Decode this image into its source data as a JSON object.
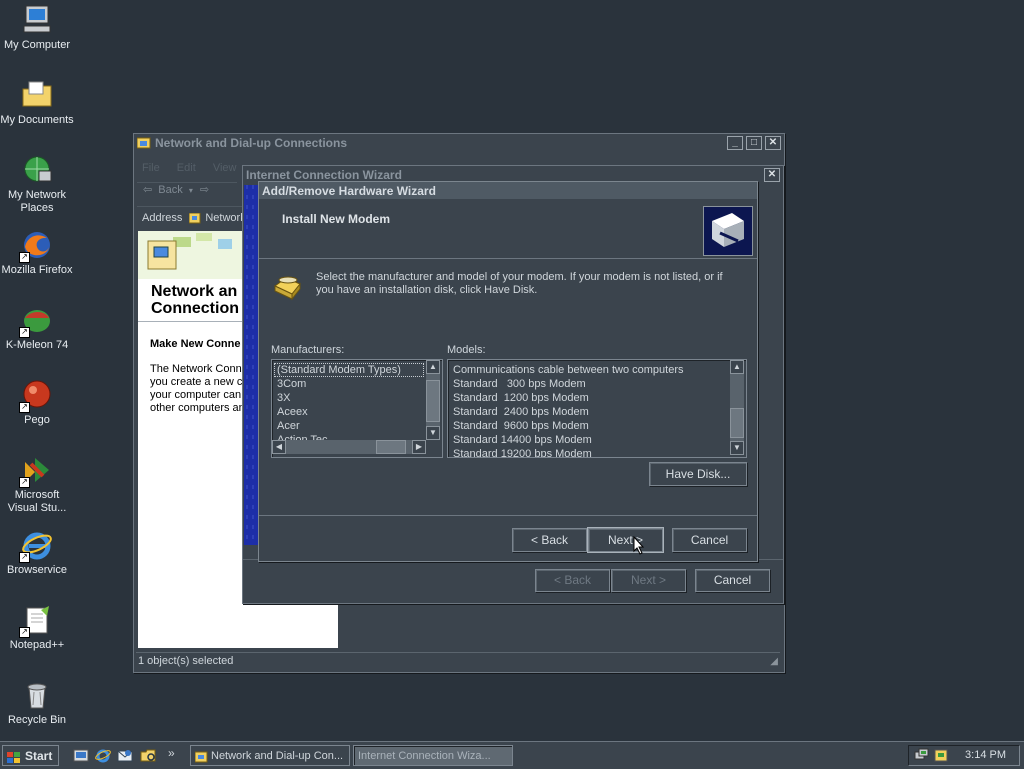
{
  "desktop": {
    "icons": [
      {
        "label": "My Computer"
      },
      {
        "label": "My Documents"
      },
      {
        "label": "My Network Places"
      },
      {
        "label": "Mozilla Firefox"
      },
      {
        "label": "K-Meleon 74"
      },
      {
        "label": "Pego"
      },
      {
        "label": "Microsoft Visual Stu..."
      },
      {
        "label": "Browservice"
      },
      {
        "label": "Notepad++"
      },
      {
        "label": "Recycle Bin"
      }
    ]
  },
  "network_window": {
    "title": "Network and Dial-up Connections",
    "menu": [
      "File",
      "Edit",
      "View"
    ],
    "toolbar": {
      "back": "Back"
    },
    "address_label": "Address",
    "address_value": "Network",
    "heading": "Network and Dial-up Connections",
    "heading_visible_1": "Network an",
    "heading_visible_2": "Connection",
    "make_new": "Make New Conne",
    "body_lines": [
      "The Network Conne",
      "you create a new c",
      "your computer can",
      "other computers an"
    ],
    "status": "1 object(s) selected"
  },
  "ics_wizard": {
    "title": "Internet Connection Wizard",
    "back": "< Back",
    "next": "Next >",
    "cancel": "Cancel"
  },
  "hw_wizard": {
    "title": "Add/Remove Hardware Wizard",
    "header": "Install New Modem",
    "instruction": "Select the manufacturer and model of your modem. If your modem is not listed, or if you have an installation disk, click Have Disk.",
    "manufacturers_label": "Manufacturers:",
    "models_label": "Models:",
    "manufacturers": [
      "(Standard Modem Types)",
      "3Com",
      "3X",
      "Aceex",
      "Acer",
      "Action Tec"
    ],
    "models": [
      "Communications cable between two computers",
      "Standard   300 bps Modem",
      "Standard  1200 bps Modem",
      "Standard  2400 bps Modem",
      "Standard  9600 bps Modem",
      "Standard 14400 bps Modem",
      "Standard 19200 bps Modem"
    ],
    "have_disk": "Have Disk...",
    "back": "< Back",
    "next": "Next >",
    "cancel": "Cancel"
  },
  "taskbar": {
    "start": "Start",
    "tasks": [
      {
        "label": "Network and Dial-up Con..."
      },
      {
        "label": "Internet Connection Wiza..."
      }
    ],
    "clock": "3:14 PM"
  }
}
